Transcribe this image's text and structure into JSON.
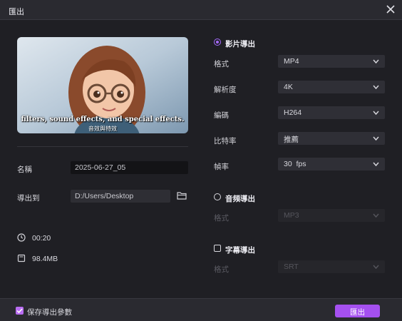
{
  "window": {
    "title": "匯出"
  },
  "preview": {
    "caption_line1": "filters, sound effects, and special effects.",
    "caption_line2": "音效與特效"
  },
  "left": {
    "name_label": "名稱",
    "name_value": "2025-06-27_05",
    "export_to_label": "導出到",
    "export_path": "D:/Users/Desktop",
    "duration": "00:20",
    "file_size": "98.4MB"
  },
  "video_export": {
    "title": "影片導出",
    "rows": [
      {
        "label": "格式",
        "value": "MP4"
      },
      {
        "label": "解析度",
        "value": "4K"
      },
      {
        "label": "編碼",
        "value": "H264"
      },
      {
        "label": "比特率",
        "value": "推薦"
      },
      {
        "label": "幀率",
        "value": "30  fps"
      }
    ]
  },
  "audio_export": {
    "title": "音頻導出",
    "format_label": "格式",
    "format_value": "MP3"
  },
  "subtitle_export": {
    "title": "字幕導出",
    "format_label": "格式",
    "format_value": "SRT"
  },
  "footer": {
    "save_params_label": "保存導出參數",
    "export_button": "匯出"
  },
  "colors": {
    "accent": "#a550f0",
    "background": "#1f1f24",
    "panel": "#2a2a30"
  }
}
